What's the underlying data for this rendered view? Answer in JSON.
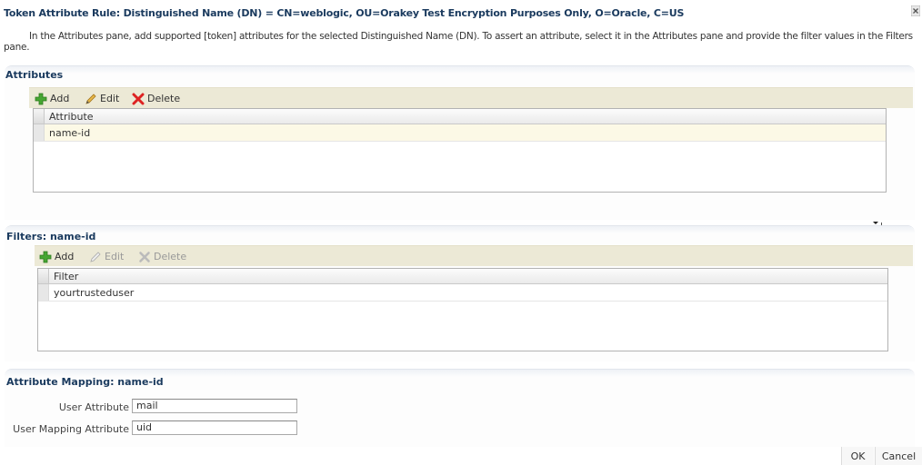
{
  "dialog": {
    "title": "Token Attribute Rule: Distinguished Name (DN) = CN=weblogic, OU=Orakey Test Encryption Purposes Only, O=Oracle, C=US",
    "close_icon": "close-icon",
    "instructions": "In the Attributes pane, add supported [token] attributes for the selected Distinguished Name (DN). To assert an attribute, select it in the Attributes pane and provide the filter values in the Filters pane."
  },
  "attributes": {
    "title": "Attributes",
    "toolbar": {
      "add_label": "Add",
      "edit_label": "Edit",
      "delete_label": "Delete"
    },
    "table": {
      "column_header": "Attribute",
      "rows": [
        "name-id"
      ]
    }
  },
  "filters": {
    "title": "Filters: name-id",
    "toolbar": {
      "add_label": "Add",
      "edit_label": "Edit",
      "delete_label": "Delete"
    },
    "table": {
      "column_header": "Filter",
      "rows": [
        "yourtrusteduser"
      ]
    }
  },
  "mapping": {
    "title": "Attribute Mapping: name-id",
    "user_attribute_label": "User Attribute",
    "user_attribute_value": "mail",
    "user_mapping_attribute_label": "User Mapping Attribute",
    "user_mapping_attribute_value": "uid"
  },
  "footer": {
    "ok_label": "OK",
    "cancel_label": "Cancel"
  },
  "colors": {
    "title_text": "#1a3a5e",
    "toolbar_bg": "#ece9d6",
    "selected_row_bg": "#fcf9e6",
    "add_icon": "#3a9a2a",
    "delete_icon": "#cc2222"
  },
  "icons": {
    "add": "plus-icon",
    "edit": "pencil-icon",
    "delete": "delete-x-icon",
    "splitter": "collapse-arrow-icon"
  }
}
